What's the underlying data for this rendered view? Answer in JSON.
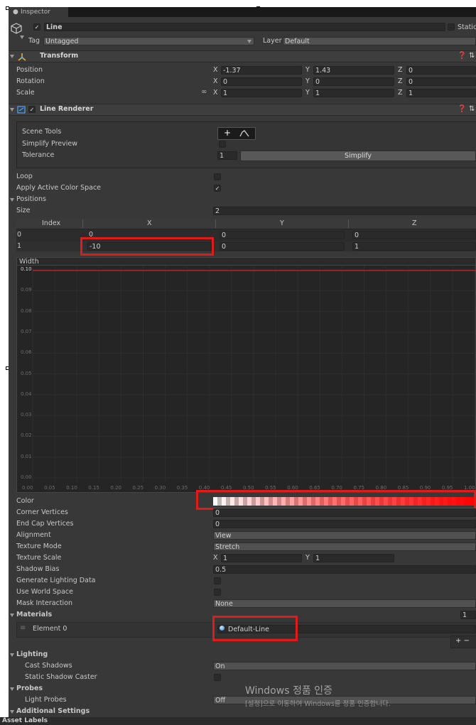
{
  "inspector": {
    "tab_label": "Inspector",
    "object_name": "Line",
    "static_label": "Static",
    "tag_label": "Tag",
    "tag_value": "Untagged",
    "layer_label": "Layer",
    "layer_value": "Default"
  },
  "transform": {
    "title": "Transform",
    "rows": [
      {
        "label": "Position",
        "x": "-1.37",
        "y": "1.43",
        "z": "0"
      },
      {
        "label": "Rotation",
        "x": "0",
        "y": "0",
        "z": "0"
      },
      {
        "label": "Scale",
        "x": "1",
        "y": "1",
        "z": "1"
      }
    ],
    "axis_x": "X",
    "axis_y": "Y",
    "axis_z": "Z"
  },
  "line_renderer": {
    "title": "Line Renderer",
    "scene_tools_label": "Scene Tools",
    "simplify_preview_label": "Simplify Preview",
    "tolerance_label": "Tolerance",
    "tolerance_value": "1",
    "simplify_button": "Simplify",
    "plus_symbol": "+",
    "loop_label": "Loop",
    "apply_color_label": "Apply Active Color Space",
    "positions_label": "Positions",
    "size_label": "Size",
    "size_value": "2",
    "table_headers": [
      "Index",
      "X",
      "Y",
      "Z"
    ],
    "table_rows": [
      {
        "index": "0",
        "x": "0",
        "y": "0",
        "z": "0"
      },
      {
        "index": "1",
        "x": "-10",
        "y": "0",
        "z": "1"
      }
    ],
    "width_label": "Width",
    "width_y_ticks": [
      "0.10",
      "0.09",
      "0.08",
      "0.07",
      "0.06",
      "0.05",
      "0.04",
      "0.03",
      "0.02",
      "0.01",
      "0.00"
    ],
    "width_x_ticks": [
      "0.00",
      "0.05",
      "0.10",
      "0.15",
      "0.20",
      "0.25",
      "0.30",
      "0.35",
      "0.40",
      "0.45",
      "0.50",
      "0.55",
      "0.60",
      "0.65",
      "0.70",
      "0.75",
      "0.80",
      "0.85",
      "0.90",
      "0.95",
      "1.00"
    ],
    "props": [
      {
        "label": "Color",
        "value": ""
      },
      {
        "label": "Corner Vertices",
        "value": "0"
      },
      {
        "label": "End Cap Vertices",
        "value": "0"
      },
      {
        "label": "Alignment",
        "value": "View"
      },
      {
        "label": "Texture Mode",
        "value": "Stretch"
      },
      {
        "label": "Texture Scale",
        "value": ""
      },
      {
        "label": "Shadow Bias",
        "value": "0.5"
      },
      {
        "label": "Generate Lighting Data",
        "value": ""
      },
      {
        "label": "Use World Space",
        "value": ""
      },
      {
        "label": "Mask Interaction",
        "value": "None"
      }
    ],
    "texture_scale_x": "1",
    "texture_scale_y": "1",
    "materials_label": "Materials",
    "materials_count": "1",
    "element0_label": "Element 0",
    "element0_value": "Default-Line",
    "plus_minus": "+ −",
    "lighting_label": "Lighting",
    "cast_shadows_label": "Cast Shadows",
    "cast_shadows_value": "On",
    "static_shadow_label": "Static Shadow Caster",
    "probes_label": "Probes",
    "light_probes_label": "Light Probes",
    "light_probes_value": "Off",
    "additional_label": "Additional Settings",
    "asset_labels": "Asset Labels"
  },
  "watermark": {
    "line1": "Windows 정품 인증",
    "line2": "[설정]으로 이동하여 Windows를 정품 인증합니다."
  },
  "colors": {
    "panel_bg": "#383838",
    "field_bg": "#2a2a2a",
    "highlight_red": "#e11a1a",
    "curve_red": "#d42020"
  }
}
